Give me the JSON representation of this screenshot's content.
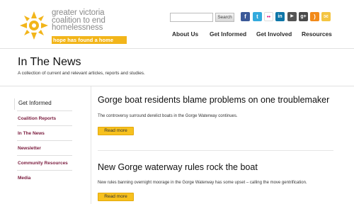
{
  "logo": {
    "line1": "greater victoria",
    "line2": "coalition to end",
    "line3": "homelessness",
    "tagline": "hope has found a home"
  },
  "search": {
    "placeholder": "",
    "button_label": "Search"
  },
  "social": [
    {
      "icon": "facebook-icon",
      "glyph": "f",
      "color": "#3b5998"
    },
    {
      "icon": "twitter-icon",
      "glyph": "t",
      "color": "#33aadd"
    },
    {
      "icon": "flickr-icon",
      "glyph": "••",
      "color": "#ffffff"
    },
    {
      "icon": "linkedin-icon",
      "glyph": "in",
      "color": "#0e76a8"
    },
    {
      "icon": "youtube-icon",
      "glyph": "▶",
      "color": "#555555"
    },
    {
      "icon": "googleplus-icon",
      "glyph": "g+",
      "color": "#4a4a4a"
    },
    {
      "icon": "rss-icon",
      "glyph": ")",
      "color": "#f28a1a"
    },
    {
      "icon": "email-icon",
      "glyph": "✉",
      "color": "#f4c542"
    }
  ],
  "nav": [
    "About Us",
    "Get Informed",
    "Get Involved",
    "Resources"
  ],
  "page": {
    "title": "In The News",
    "subtitle": "A collection of current and relevant articles, reports and studies."
  },
  "sidebar": {
    "title": "Get Informed",
    "items": [
      "Coalition Reports",
      "In The News",
      "Newsletter",
      "Community Resources",
      "Media"
    ]
  },
  "articles": [
    {
      "title": "Gorge boat residents blame problems on one troublemaker",
      "body": "The controversy surround derelict boats in the Gorge Waterway continues.",
      "cta": "Read more"
    },
    {
      "title": "New Gorge waterway rules rock the boat",
      "body": "New rules banning overnight moorage in the Gorge Waterway has some upset – calling the move gentrification.",
      "cta": "Read more"
    }
  ],
  "colors": {
    "accent": "#f7c11e",
    "sidebar_link": "#7a1a3c",
    "logo_orange": "#f2b51a"
  }
}
